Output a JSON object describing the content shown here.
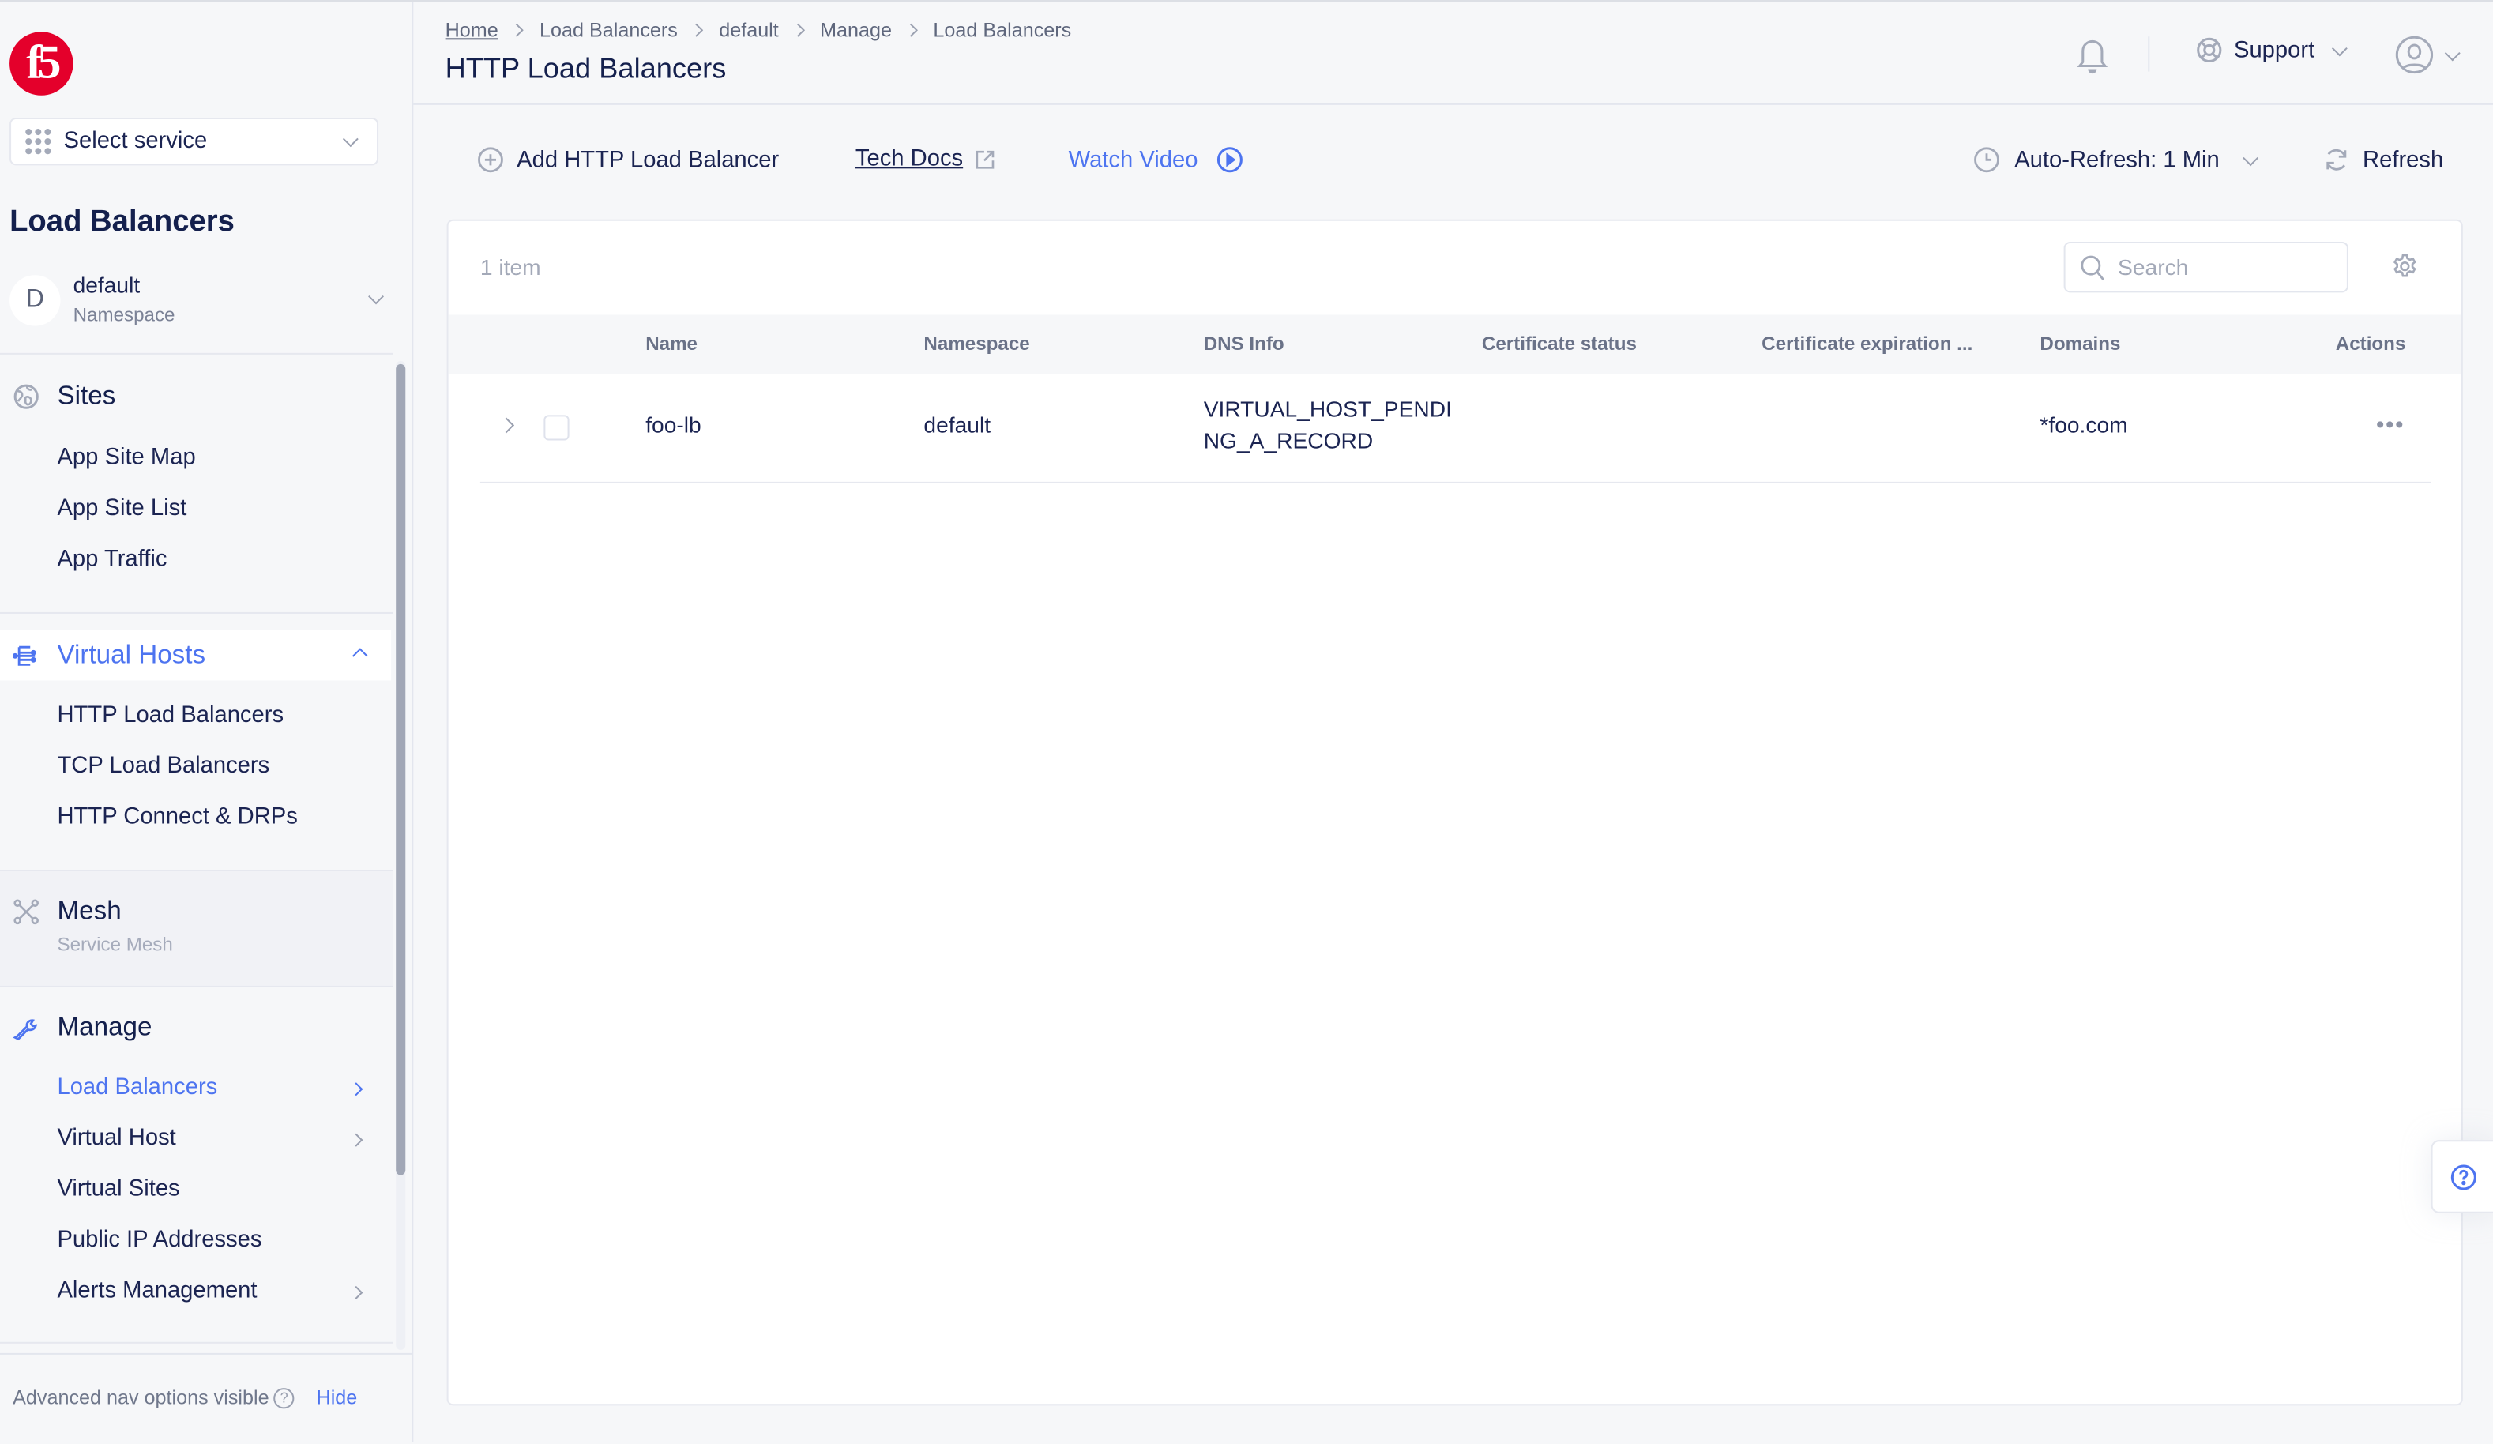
{
  "brand": {
    "logo_text": "f5",
    "logo_color": "#e4002b",
    "accent_color": "#4d74f0"
  },
  "sidebar": {
    "service_select": {
      "label": "Select service",
      "icon": "grid-dots-icon"
    },
    "title": "Load Balancers",
    "namespace": {
      "avatar": "D",
      "name": "default",
      "sublabel": "Namespace"
    },
    "sections": [
      {
        "label": "Sites",
        "icon": "globe-icon",
        "items": [
          {
            "label": "App Site Map"
          },
          {
            "label": "App Site List"
          },
          {
            "label": "App Traffic"
          }
        ]
      },
      {
        "label": "Virtual Hosts",
        "icon": "virtual-hosts-icon",
        "active": true,
        "expanded": true,
        "items": [
          {
            "label": "HTTP Load Balancers"
          },
          {
            "label": "TCP Load Balancers"
          },
          {
            "label": "HTTP Connect & DRPs"
          }
        ]
      },
      {
        "label": "Mesh",
        "icon": "mesh-icon",
        "sublabel": "Service Mesh",
        "items": []
      },
      {
        "label": "Manage",
        "icon": "wrench-icon",
        "items": [
          {
            "label": "Load Balancers",
            "active": true,
            "has_submenu": true
          },
          {
            "label": "Virtual Host",
            "has_submenu": true
          },
          {
            "label": "Virtual Sites"
          },
          {
            "label": "Public IP Addresses"
          },
          {
            "label": "Alerts Management",
            "has_submenu": true
          }
        ]
      }
    ],
    "footer": {
      "text": "Advanced nav options visible",
      "hide_label": "Hide"
    }
  },
  "header": {
    "breadcrumb": [
      "Home",
      "Load Balancers",
      "default",
      "Manage",
      "Load Balancers"
    ],
    "title": "HTTP Load Balancers",
    "support_label": "Support"
  },
  "toolbar": {
    "add_label": "Add HTTP Load Balancer",
    "docs_label": "Tech Docs",
    "video_label": "Watch Video",
    "auto_refresh_label": "Auto-Refresh: 1 Min",
    "refresh_label": "Refresh"
  },
  "table": {
    "count_label": "1 item",
    "search_placeholder": "Search",
    "columns": [
      "Name",
      "Namespace",
      "DNS Info",
      "Certificate status",
      "Certificate expiration ...",
      "Domains",
      "Actions"
    ],
    "rows": [
      {
        "name": "foo-lb",
        "namespace": "default",
        "dns_info_line1": "VIRTUAL_HOST_PENDI",
        "dns_info_line2": "NG_A_RECORD",
        "certificate_status": "",
        "certificate_expiration": "",
        "domains": "*foo.com"
      }
    ]
  }
}
